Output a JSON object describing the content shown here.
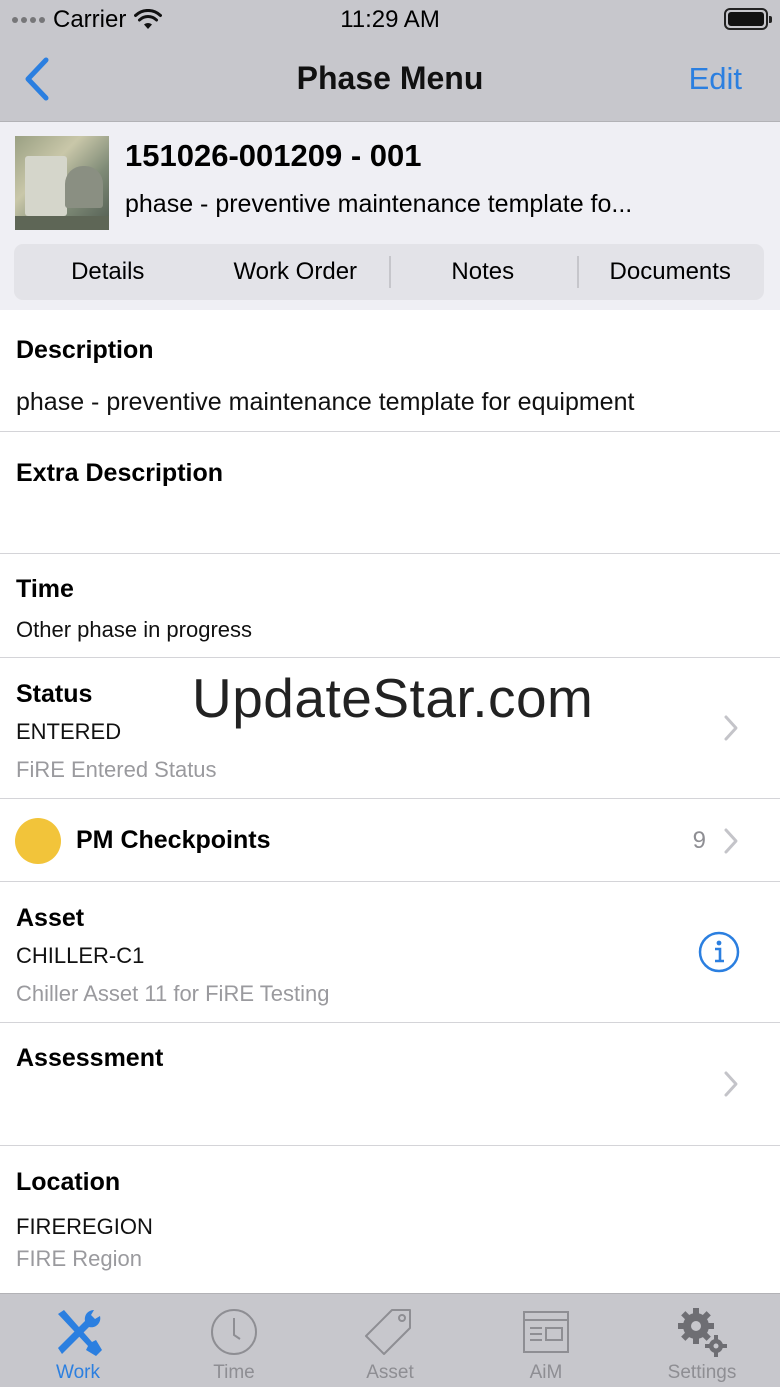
{
  "status_bar": {
    "carrier": "Carrier",
    "time": "11:29 AM"
  },
  "nav": {
    "title": "Phase Menu",
    "edit_label": "Edit"
  },
  "header": {
    "wo_number": "151026-001209 - 001",
    "wo_description": "phase - preventive maintenance template fo...",
    "tabs": [
      "Details",
      "Work Order",
      "Notes",
      "Documents"
    ]
  },
  "sections": {
    "description": {
      "label": "Description",
      "value": "phase - preventive maintenance template for equipment"
    },
    "extra_description": {
      "label": "Extra Description"
    },
    "time": {
      "label": "Time",
      "value": "Other phase in progress"
    },
    "status": {
      "label": "Status",
      "value": "ENTERED",
      "sub": "FiRE Entered Status"
    },
    "pm_checkpoints": {
      "label": "PM Checkpoints",
      "count": "9",
      "indicator_color": "#f2c43a"
    },
    "asset": {
      "label": "Asset",
      "value": "CHILLER-C1",
      "sub": "Chiller Asset 11 for FiRE Testing"
    },
    "assessment": {
      "label": "Assessment"
    },
    "location": {
      "label": "Location",
      "value": "FIREREGION",
      "sub": "FIRE Region"
    }
  },
  "watermark": "UpdateStar.com",
  "tab_bar": {
    "items": [
      {
        "label": "Work",
        "icon": "tools-icon",
        "active": true
      },
      {
        "label": "Time",
        "icon": "clock-icon",
        "active": false
      },
      {
        "label": "Asset",
        "icon": "tag-icon",
        "active": false
      },
      {
        "label": "AiM",
        "icon": "browser-window-icon",
        "active": false
      },
      {
        "label": "Settings",
        "icon": "gear-icon",
        "active": false
      }
    ]
  },
  "colors": {
    "accent": "#2b7fe0",
    "bar_background": "#c7c7cc",
    "header_background": "#efeff4"
  }
}
